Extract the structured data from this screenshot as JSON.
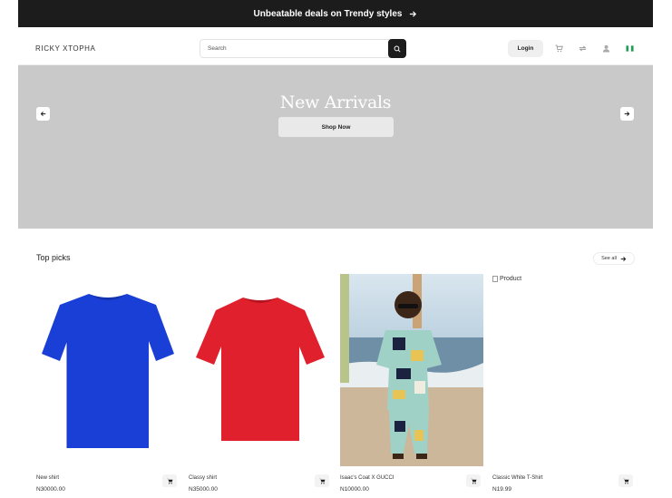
{
  "promo": {
    "text": "Unbeatable deals on Trendy styles"
  },
  "header": {
    "brand": "RICKY XTOPHA",
    "search_placeholder": "Search",
    "login_label": "Login",
    "icons": [
      "cart-icon",
      "compare-icon",
      "user-icon",
      "nigeria-flag-icon"
    ]
  },
  "hero": {
    "title": "New Arrivals",
    "cta_label": "Shop Now",
    "background": "#c9c9c9"
  },
  "section": {
    "title": "Top picks",
    "see_all_label": "See all"
  },
  "products": [
    {
      "name": "New shirt",
      "price": "N30000.00",
      "image": "blue-tshirt",
      "color": "#1a3fd6"
    },
    {
      "name": "Classy shirt",
      "price": "N35000.00",
      "image": "red-tshirt",
      "color": "#e0202c"
    },
    {
      "name": "Isaac's Coat X GUCCI",
      "price": "N10000.00",
      "image": "man-patterned-outfit-beach"
    },
    {
      "name": "Classic White T-Shirt",
      "price": "N19.99",
      "image_alt": "Product"
    }
  ],
  "colors": {
    "dark": "#1c1c1c",
    "accent_flag": "#1f9d55"
  }
}
